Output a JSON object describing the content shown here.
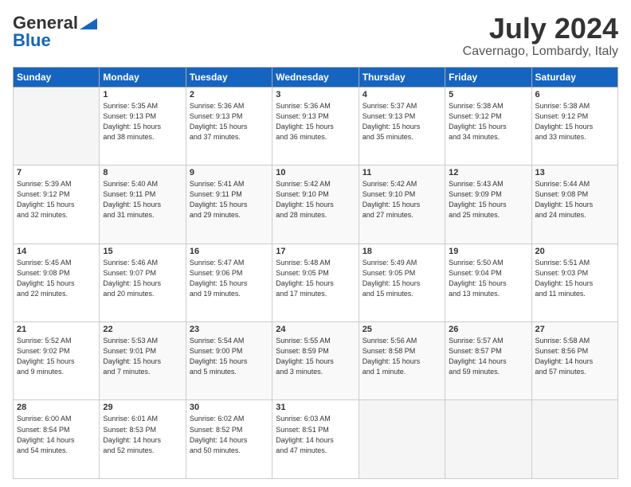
{
  "header": {
    "logo_general": "General",
    "logo_blue": "Blue",
    "month": "July 2024",
    "location": "Cavernago, Lombardy, Italy"
  },
  "columns": [
    "Sunday",
    "Monday",
    "Tuesday",
    "Wednesday",
    "Thursday",
    "Friday",
    "Saturday"
  ],
  "weeks": [
    [
      {
        "day": "",
        "content": ""
      },
      {
        "day": "1",
        "content": "Sunrise: 5:35 AM\nSunset: 9:13 PM\nDaylight: 15 hours\nand 38 minutes."
      },
      {
        "day": "2",
        "content": "Sunrise: 5:36 AM\nSunset: 9:13 PM\nDaylight: 15 hours\nand 37 minutes."
      },
      {
        "day": "3",
        "content": "Sunrise: 5:36 AM\nSunset: 9:13 PM\nDaylight: 15 hours\nand 36 minutes."
      },
      {
        "day": "4",
        "content": "Sunrise: 5:37 AM\nSunset: 9:13 PM\nDaylight: 15 hours\nand 35 minutes."
      },
      {
        "day": "5",
        "content": "Sunrise: 5:38 AM\nSunset: 9:12 PM\nDaylight: 15 hours\nand 34 minutes."
      },
      {
        "day": "6",
        "content": "Sunrise: 5:38 AM\nSunset: 9:12 PM\nDaylight: 15 hours\nand 33 minutes."
      }
    ],
    [
      {
        "day": "7",
        "content": "Sunrise: 5:39 AM\nSunset: 9:12 PM\nDaylight: 15 hours\nand 32 minutes."
      },
      {
        "day": "8",
        "content": "Sunrise: 5:40 AM\nSunset: 9:11 PM\nDaylight: 15 hours\nand 31 minutes."
      },
      {
        "day": "9",
        "content": "Sunrise: 5:41 AM\nSunset: 9:11 PM\nDaylight: 15 hours\nand 29 minutes."
      },
      {
        "day": "10",
        "content": "Sunrise: 5:42 AM\nSunset: 9:10 PM\nDaylight: 15 hours\nand 28 minutes."
      },
      {
        "day": "11",
        "content": "Sunrise: 5:42 AM\nSunset: 9:10 PM\nDaylight: 15 hours\nand 27 minutes."
      },
      {
        "day": "12",
        "content": "Sunrise: 5:43 AM\nSunset: 9:09 PM\nDaylight: 15 hours\nand 25 minutes."
      },
      {
        "day": "13",
        "content": "Sunrise: 5:44 AM\nSunset: 9:08 PM\nDaylight: 15 hours\nand 24 minutes."
      }
    ],
    [
      {
        "day": "14",
        "content": "Sunrise: 5:45 AM\nSunset: 9:08 PM\nDaylight: 15 hours\nand 22 minutes."
      },
      {
        "day": "15",
        "content": "Sunrise: 5:46 AM\nSunset: 9:07 PM\nDaylight: 15 hours\nand 20 minutes."
      },
      {
        "day": "16",
        "content": "Sunrise: 5:47 AM\nSunset: 9:06 PM\nDaylight: 15 hours\nand 19 minutes."
      },
      {
        "day": "17",
        "content": "Sunrise: 5:48 AM\nSunset: 9:05 PM\nDaylight: 15 hours\nand 17 minutes."
      },
      {
        "day": "18",
        "content": "Sunrise: 5:49 AM\nSunset: 9:05 PM\nDaylight: 15 hours\nand 15 minutes."
      },
      {
        "day": "19",
        "content": "Sunrise: 5:50 AM\nSunset: 9:04 PM\nDaylight: 15 hours\nand 13 minutes."
      },
      {
        "day": "20",
        "content": "Sunrise: 5:51 AM\nSunset: 9:03 PM\nDaylight: 15 hours\nand 11 minutes."
      }
    ],
    [
      {
        "day": "21",
        "content": "Sunrise: 5:52 AM\nSunset: 9:02 PM\nDaylight: 15 hours\nand 9 minutes."
      },
      {
        "day": "22",
        "content": "Sunrise: 5:53 AM\nSunset: 9:01 PM\nDaylight: 15 hours\nand 7 minutes."
      },
      {
        "day": "23",
        "content": "Sunrise: 5:54 AM\nSunset: 9:00 PM\nDaylight: 15 hours\nand 5 minutes."
      },
      {
        "day": "24",
        "content": "Sunrise: 5:55 AM\nSunset: 8:59 PM\nDaylight: 15 hours\nand 3 minutes."
      },
      {
        "day": "25",
        "content": "Sunrise: 5:56 AM\nSunset: 8:58 PM\nDaylight: 15 hours\nand 1 minute."
      },
      {
        "day": "26",
        "content": "Sunrise: 5:57 AM\nSunset: 8:57 PM\nDaylight: 14 hours\nand 59 minutes."
      },
      {
        "day": "27",
        "content": "Sunrise: 5:58 AM\nSunset: 8:56 PM\nDaylight: 14 hours\nand 57 minutes."
      }
    ],
    [
      {
        "day": "28",
        "content": "Sunrise: 6:00 AM\nSunset: 8:54 PM\nDaylight: 14 hours\nand 54 minutes."
      },
      {
        "day": "29",
        "content": "Sunrise: 6:01 AM\nSunset: 8:53 PM\nDaylight: 14 hours\nand 52 minutes."
      },
      {
        "day": "30",
        "content": "Sunrise: 6:02 AM\nSunset: 8:52 PM\nDaylight: 14 hours\nand 50 minutes."
      },
      {
        "day": "31",
        "content": "Sunrise: 6:03 AM\nSunset: 8:51 PM\nDaylight: 14 hours\nand 47 minutes."
      },
      {
        "day": "",
        "content": ""
      },
      {
        "day": "",
        "content": ""
      },
      {
        "day": "",
        "content": ""
      }
    ]
  ]
}
